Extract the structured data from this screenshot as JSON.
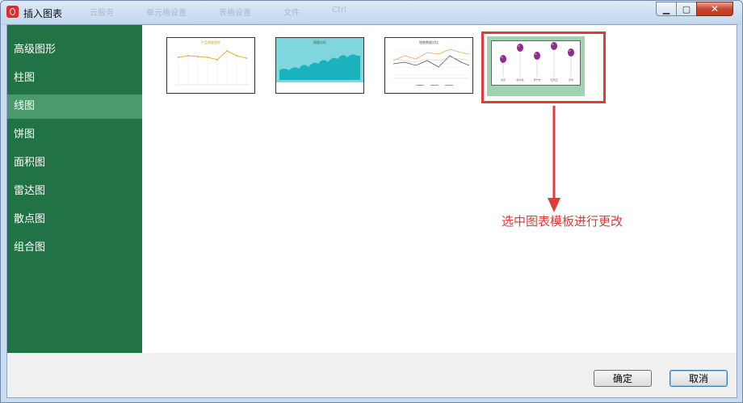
{
  "window": {
    "title": "插入图表"
  },
  "ghost_titles": [
    "云服务",
    "单元格设置",
    "表格设置",
    "文件",
    "Ctrl"
  ],
  "sidebar": {
    "items": [
      {
        "label": "高级图形",
        "active": false
      },
      {
        "label": "柱图",
        "active": false
      },
      {
        "label": "线图",
        "active": true
      },
      {
        "label": "饼图",
        "active": false
      },
      {
        "label": "面积图",
        "active": false
      },
      {
        "label": "雷达图",
        "active": false
      },
      {
        "label": "散点图",
        "active": false
      },
      {
        "label": "组合图",
        "active": false
      }
    ]
  },
  "templates": [
    {
      "title": "产品销量趋势"
    },
    {
      "title": "销量分析"
    },
    {
      "title": "销售数据对比"
    },
    {
      "title": "",
      "selected": true,
      "categories": [
        "北京",
        "哈尔滨",
        "济宁市",
        "石家庄",
        "京市"
      ]
    }
  ],
  "annotation": {
    "text": "选中图表模板进行更改",
    "color": "#e03a3a"
  },
  "buttons": {
    "ok": "确定",
    "cancel": "取消"
  },
  "colors": {
    "sidebar_bg": "#217346",
    "sidebar_active": "#4a9a6e",
    "accent_red": "#e03a3a"
  }
}
